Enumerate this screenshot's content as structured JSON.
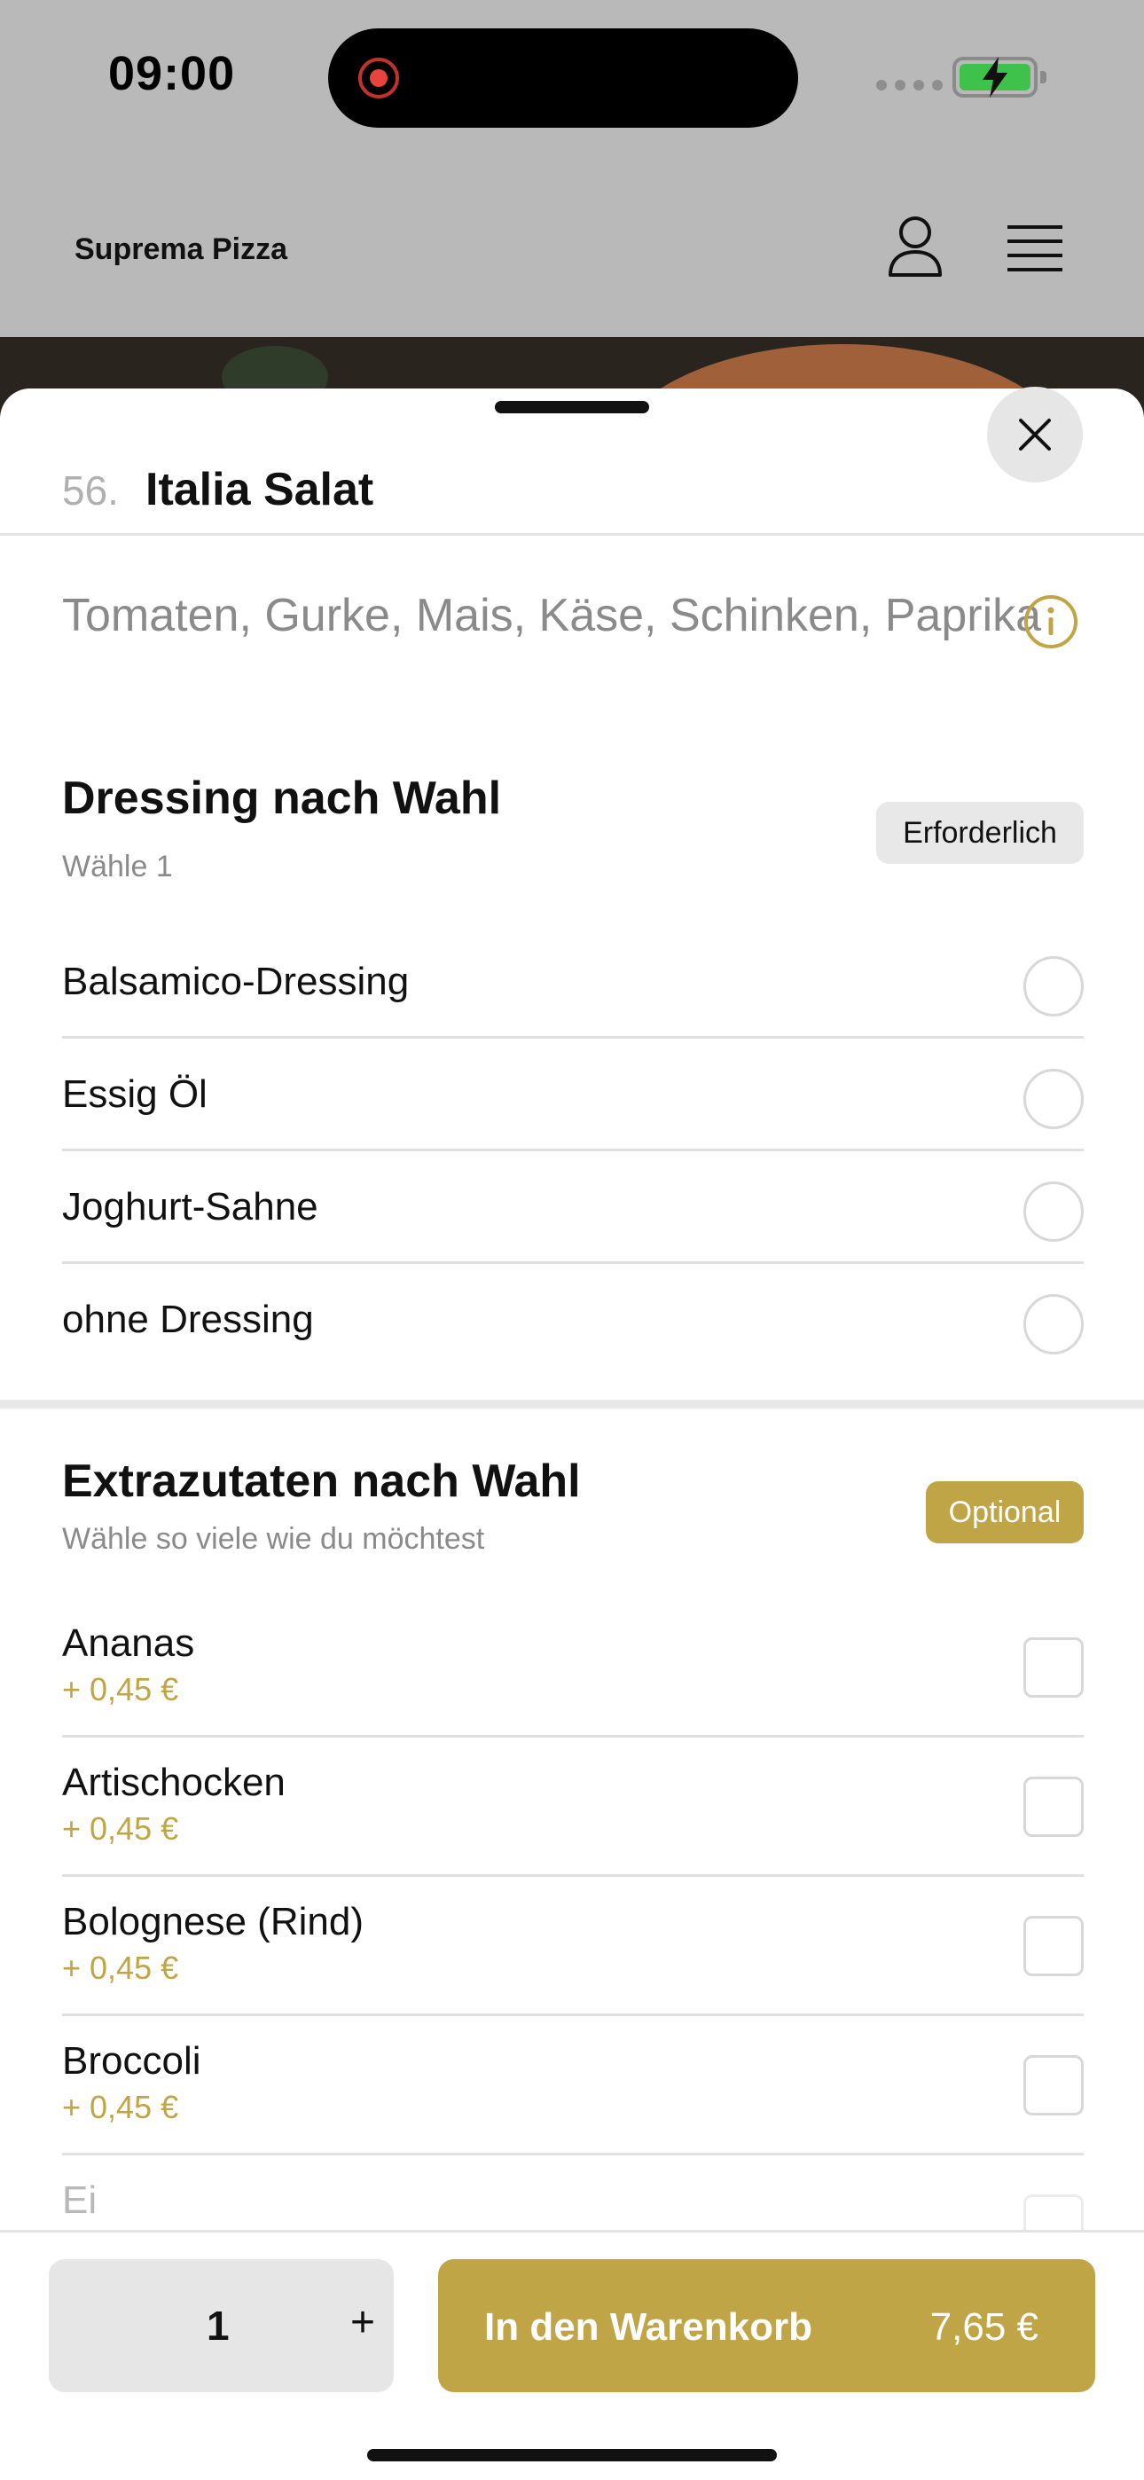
{
  "status_bar": {
    "time": "09:00"
  },
  "app_bar": {
    "brand": "Suprema Pizza"
  },
  "item": {
    "number": "56.",
    "title": "Italia Salat",
    "description": "Tomaten, Gurke, Mais, Käse, Schinken, Paprika"
  },
  "dressing": {
    "title": "Dressing nach Wahl",
    "subtitle": "Wähle 1",
    "badge": "Erforderlich",
    "options": [
      "Balsamico-Dressing",
      "Essig Öl",
      "Joghurt-Sahne",
      "ohne Dressing"
    ]
  },
  "extras": {
    "title": "Extrazutaten nach Wahl",
    "subtitle": "Wähle so viele wie du möchtest",
    "badge": "Optional",
    "options": [
      {
        "label": "Ananas",
        "price": "+ 0,45 €"
      },
      {
        "label": "Artischocken",
        "price": "+ 0,45 €"
      },
      {
        "label": "Bolognese (Rind)",
        "price": "+ 0,45 €"
      },
      {
        "label": "Broccoli",
        "price": "+ 0,45 €"
      },
      {
        "label": "Ei"
      }
    ]
  },
  "footer": {
    "quantity": "1",
    "plus": "+",
    "cart_label": "In den Warenkorb",
    "cart_price": "7,65 €"
  },
  "colors": {
    "accent": "#c0a546",
    "background_dim": "#b9b9b9"
  }
}
